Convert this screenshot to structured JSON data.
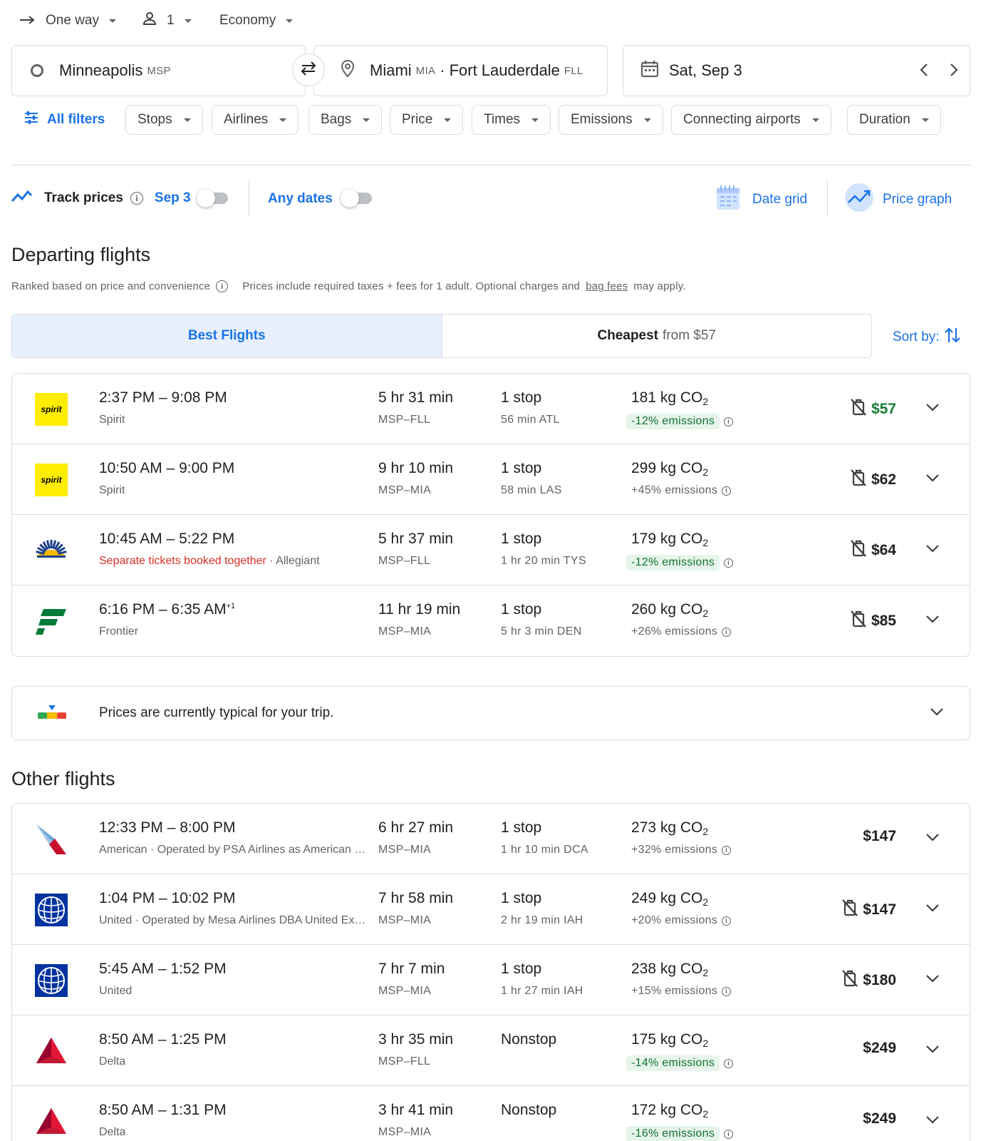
{
  "trip": {
    "type": "One way",
    "passengers": "1",
    "cabin": "Economy"
  },
  "search": {
    "origin_city": "Minneapolis",
    "origin_code": "MSP",
    "dest_city1": "Miami",
    "dest_code1": "MIA",
    "dest_sep": "·",
    "dest_city2": "Fort Lauderdale",
    "dest_code2": "FLL",
    "date": "Sat, Sep 3"
  },
  "filters": {
    "all": "All filters",
    "chips": [
      "Stops",
      "Airlines",
      "Bags",
      "Price",
      "Times",
      "Emissions",
      "Connecting airports",
      "Duration"
    ]
  },
  "tracking": {
    "track_label": "Track prices",
    "track_date": "Sep 3",
    "any_dates": "Any dates",
    "date_grid": "Date grid",
    "price_graph": "Price graph"
  },
  "departing": {
    "title": "Departing flights",
    "ranked": "Ranked based on price and convenience",
    "prices_note_1": "Prices include required taxes + fees for 1 adult. Optional charges and",
    "prices_note_link": "bag fees",
    "prices_note_2": "may apply."
  },
  "tabs": {
    "best": "Best Flights",
    "cheapest": "Cheapest",
    "cheapest_from": "from $57",
    "sort": "Sort by:"
  },
  "best_flights": [
    {
      "logo": "spirit",
      "times": "2:37 PM – 9:08 PM",
      "sup": "",
      "sep_label": "",
      "airline": "Spirit",
      "duration": "5 hr 31 min",
      "route": "MSP–FLL",
      "stops": "1 stop",
      "layover": "56 min ATL",
      "co2": "181 kg CO",
      "emissions": "-12% emissions",
      "badge": true,
      "price": "$57",
      "price_color": "#188038",
      "no_bag": true
    },
    {
      "logo": "spirit",
      "times": "10:50 AM – 9:00 PM",
      "sup": "",
      "sep_label": "",
      "airline": "Spirit",
      "duration": "9 hr 10 min",
      "route": "MSP–MIA",
      "stops": "1 stop",
      "layover": "58 min LAS",
      "co2": "299 kg CO",
      "emissions": "+45% emissions",
      "badge": false,
      "price": "$62",
      "price_color": "#202124",
      "no_bag": true
    },
    {
      "logo": "allegiant",
      "times": "10:45 AM – 5:22 PM",
      "sup": "",
      "sep_label": "Separate tickets booked together",
      "airline": "Allegiant",
      "duration": "5 hr 37 min",
      "route": "MSP–FLL",
      "stops": "1 stop",
      "layover": "1 hr 20 min TYS",
      "co2": "179 kg CO",
      "emissions": "-12% emissions",
      "badge": true,
      "price": "$64",
      "price_color": "#202124",
      "no_bag": true
    },
    {
      "logo": "frontier",
      "times": "6:16 PM – 6:35 AM",
      "sup": "+1",
      "sep_label": "",
      "airline": "Frontier",
      "duration": "11 hr 19 min",
      "route": "MSP–MIA",
      "stops": "1 stop",
      "layover": "5 hr 3 min DEN",
      "co2": "260 kg CO",
      "emissions": "+26% emissions",
      "badge": false,
      "price": "$85",
      "price_color": "#202124",
      "no_bag": true
    }
  ],
  "insight": "Prices are currently typical for your trip.",
  "other": {
    "title": "Other flights"
  },
  "other_flights": [
    {
      "logo": "american",
      "times": "12:33 PM – 8:00 PM",
      "sup": "",
      "sep_label": "",
      "airline": "American · Operated by PSA Airlines as American Eagle",
      "duration": "6 hr 27 min",
      "route": "MSP–MIA",
      "stops": "1 stop",
      "layover": "1 hr 10 min DCA",
      "co2": "273 kg CO",
      "emissions": "+32% emissions",
      "badge": false,
      "price": "$147",
      "price_color": "#202124",
      "no_bag": false
    },
    {
      "logo": "united",
      "times": "1:04 PM – 10:02 PM",
      "sup": "",
      "sep_label": "",
      "airline": "United · Operated by Mesa Airlines DBA United Express",
      "duration": "7 hr 58 min",
      "route": "MSP–MIA",
      "stops": "1 stop",
      "layover": "2 hr 19 min IAH",
      "co2": "249 kg CO",
      "emissions": "+20% emissions",
      "badge": false,
      "price": "$147",
      "price_color": "#202124",
      "no_bag": true
    },
    {
      "logo": "united",
      "times": "5:45 AM – 1:52 PM",
      "sup": "",
      "sep_label": "",
      "airline": "United",
      "duration": "7 hr 7 min",
      "route": "MSP–MIA",
      "stops": "1 stop",
      "layover": "1 hr 27 min IAH",
      "co2": "238 kg CO",
      "emissions": "+15% emissions",
      "badge": false,
      "price": "$180",
      "price_color": "#202124",
      "no_bag": true
    },
    {
      "logo": "delta",
      "times": "8:50 AM – 1:25 PM",
      "sup": "",
      "sep_label": "",
      "airline": "Delta",
      "duration": "3 hr 35 min",
      "route": "MSP–FLL",
      "stops": "Nonstop",
      "layover": "",
      "co2": "175 kg CO",
      "emissions": "-14% emissions",
      "badge": true,
      "price": "$249",
      "price_color": "#202124",
      "no_bag": false
    },
    {
      "logo": "delta",
      "times": "8:50 AM – 1:31 PM",
      "sup": "",
      "sep_label": "",
      "airline": "Delta",
      "duration": "3 hr 41 min",
      "route": "MSP–MIA",
      "stops": "Nonstop",
      "layover": "",
      "co2": "172 kg CO",
      "emissions": "-16% emissions",
      "badge": true,
      "price": "$249",
      "price_color": "#202124",
      "no_bag": false
    }
  ]
}
